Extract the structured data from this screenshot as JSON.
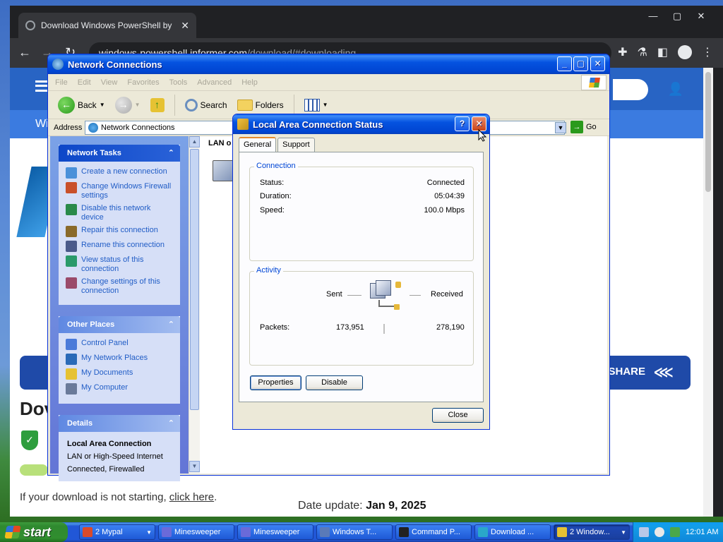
{
  "browser": {
    "tab_title": "Download Windows PowerShell by ",
    "url_host": "windows-powershell.informer.com",
    "url_path": "/download/#downloading"
  },
  "website": {
    "share_label": "SHARE",
    "big_heading": "Dov",
    "subbar_text": "Wi",
    "hint_prefix": "If your download is not starting, ",
    "hint_link": "click here",
    "hint_suffix": ".",
    "date_label": "Date update: ",
    "date_value": "Jan 9, 2025"
  },
  "netconn": {
    "title": "Network Connections",
    "menu": [
      "File",
      "Edit",
      "View",
      "Favorites",
      "Tools",
      "Advanced",
      "Help"
    ],
    "toolbar": {
      "back": "Back",
      "search": "Search",
      "folders": "Folders"
    },
    "address_label": "Address",
    "address_value": "Network Connections",
    "go_label": "Go",
    "list_header": "LAN o",
    "network_tasks": {
      "title": "Network Tasks",
      "items": [
        {
          "label": "Create a new connection",
          "icon_color": "#4a90d9"
        },
        {
          "label": "Change Windows Firewall settings",
          "icon_color": "#c9502a"
        },
        {
          "label": "Disable this network device",
          "icon_color": "#2a8a4a"
        },
        {
          "label": "Repair this connection",
          "icon_color": "#8a6a2a"
        },
        {
          "label": "Rename this connection",
          "icon_color": "#4a5a8a"
        },
        {
          "label": "View status of this connection",
          "icon_color": "#2a9a6a"
        },
        {
          "label": "Change settings of this connection",
          "icon_color": "#9a4a6a"
        }
      ]
    },
    "other_places": {
      "title": "Other Places",
      "items": [
        {
          "label": "Control Panel",
          "icon_color": "#4a7ad9"
        },
        {
          "label": "My Network Places",
          "icon_color": "#2a6ab8"
        },
        {
          "label": "My Documents",
          "icon_color": "#e6c233"
        },
        {
          "label": "My Computer",
          "icon_color": "#6a7a9a"
        }
      ]
    },
    "details": {
      "title": "Details",
      "name": "Local Area Connection",
      "line1": "LAN or High-Speed Internet",
      "line2": "Connected, Firewalled"
    }
  },
  "status_dialog": {
    "title": "Local Area Connection Status",
    "tabs": [
      "General",
      "Support"
    ],
    "connection_group": "Connection",
    "status_label": "Status:",
    "status_value": "Connected",
    "duration_label": "Duration:",
    "duration_value": "05:04:39",
    "speed_label": "Speed:",
    "speed_value": "100.0 Mbps",
    "activity_group": "Activity",
    "sent_label": "Sent",
    "received_label": "Received",
    "packets_label": "Packets:",
    "packets_sent": "173,951",
    "packets_received": "278,190",
    "properties_button": "Properties",
    "disable_button": "Disable",
    "close_button": "Close",
    "help_glyph": "?"
  },
  "taskbar": {
    "start_label": "start",
    "tasks": [
      {
        "label": "2 Mypal",
        "active": false,
        "icon_color": "#d94a2a",
        "has_dropdown": true
      },
      {
        "label": "Minesweeper",
        "active": false,
        "icon_color": "#6a6ad9",
        "has_dropdown": false
      },
      {
        "label": "Minesweeper",
        "active": false,
        "icon_color": "#6a6ad9",
        "has_dropdown": false
      },
      {
        "label": "Windows T...",
        "active": false,
        "icon_color": "#5a7ab8",
        "has_dropdown": false
      },
      {
        "label": "Command P...",
        "active": false,
        "icon_color": "#222222",
        "has_dropdown": false
      },
      {
        "label": "Download ...",
        "active": false,
        "icon_color": "#2aa8c9",
        "has_dropdown": false
      },
      {
        "label": "2 Window...",
        "active": true,
        "icon_color": "#e6c233",
        "has_dropdown": true
      }
    ],
    "clock": "12:01 AM"
  }
}
